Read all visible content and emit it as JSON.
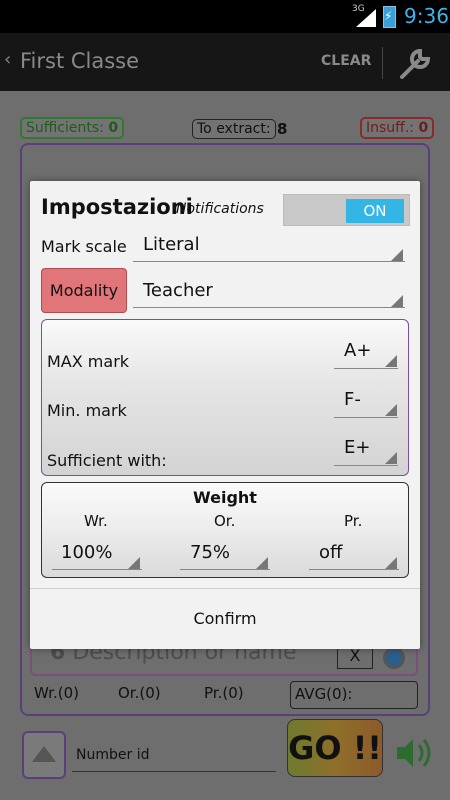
{
  "status_bar": {
    "network": "3G",
    "time": "9:36"
  },
  "action_bar": {
    "title": "First Classe",
    "clear_label": "CLEAR"
  },
  "background": {
    "sufficients_label": "Sufficients:",
    "sufficients_count": "0",
    "to_extract_label": "To extract:",
    "to_extract_count": "8",
    "insufficients_label": "Insuff.:",
    "insufficients_count": "0",
    "description_index": "6",
    "description_placeholder": "Description or name",
    "x_button": "X",
    "wr_label": "Wr.(0)",
    "or_label": "Or.(0)",
    "pr_label": "Pr.(0)",
    "avg_label": "AVG(0):",
    "number_id_placeholder": "Number id",
    "go_button": "GO !!"
  },
  "dialog": {
    "title": "Impostazioni",
    "notifications_label": "Notifications",
    "notifications_toggle": "ON",
    "mark_scale": {
      "label": "Mark scale",
      "value": "Literal"
    },
    "modality": {
      "label": "Modality",
      "value": "Teacher"
    },
    "max_mark": {
      "label": "MAX mark",
      "value": "A+"
    },
    "min_mark": {
      "label": "Min. mark",
      "value": "F-"
    },
    "sufficient_with": {
      "label": "Sufficient with:",
      "value": "E+"
    },
    "weight": {
      "title": "Weight",
      "columns": [
        {
          "label": "Wr.",
          "value": "100%"
        },
        {
          "label": "Or.",
          "value": "75%"
        },
        {
          "label": "Pr.",
          "value": "off"
        }
      ]
    },
    "confirm_label": "Confirm"
  }
}
